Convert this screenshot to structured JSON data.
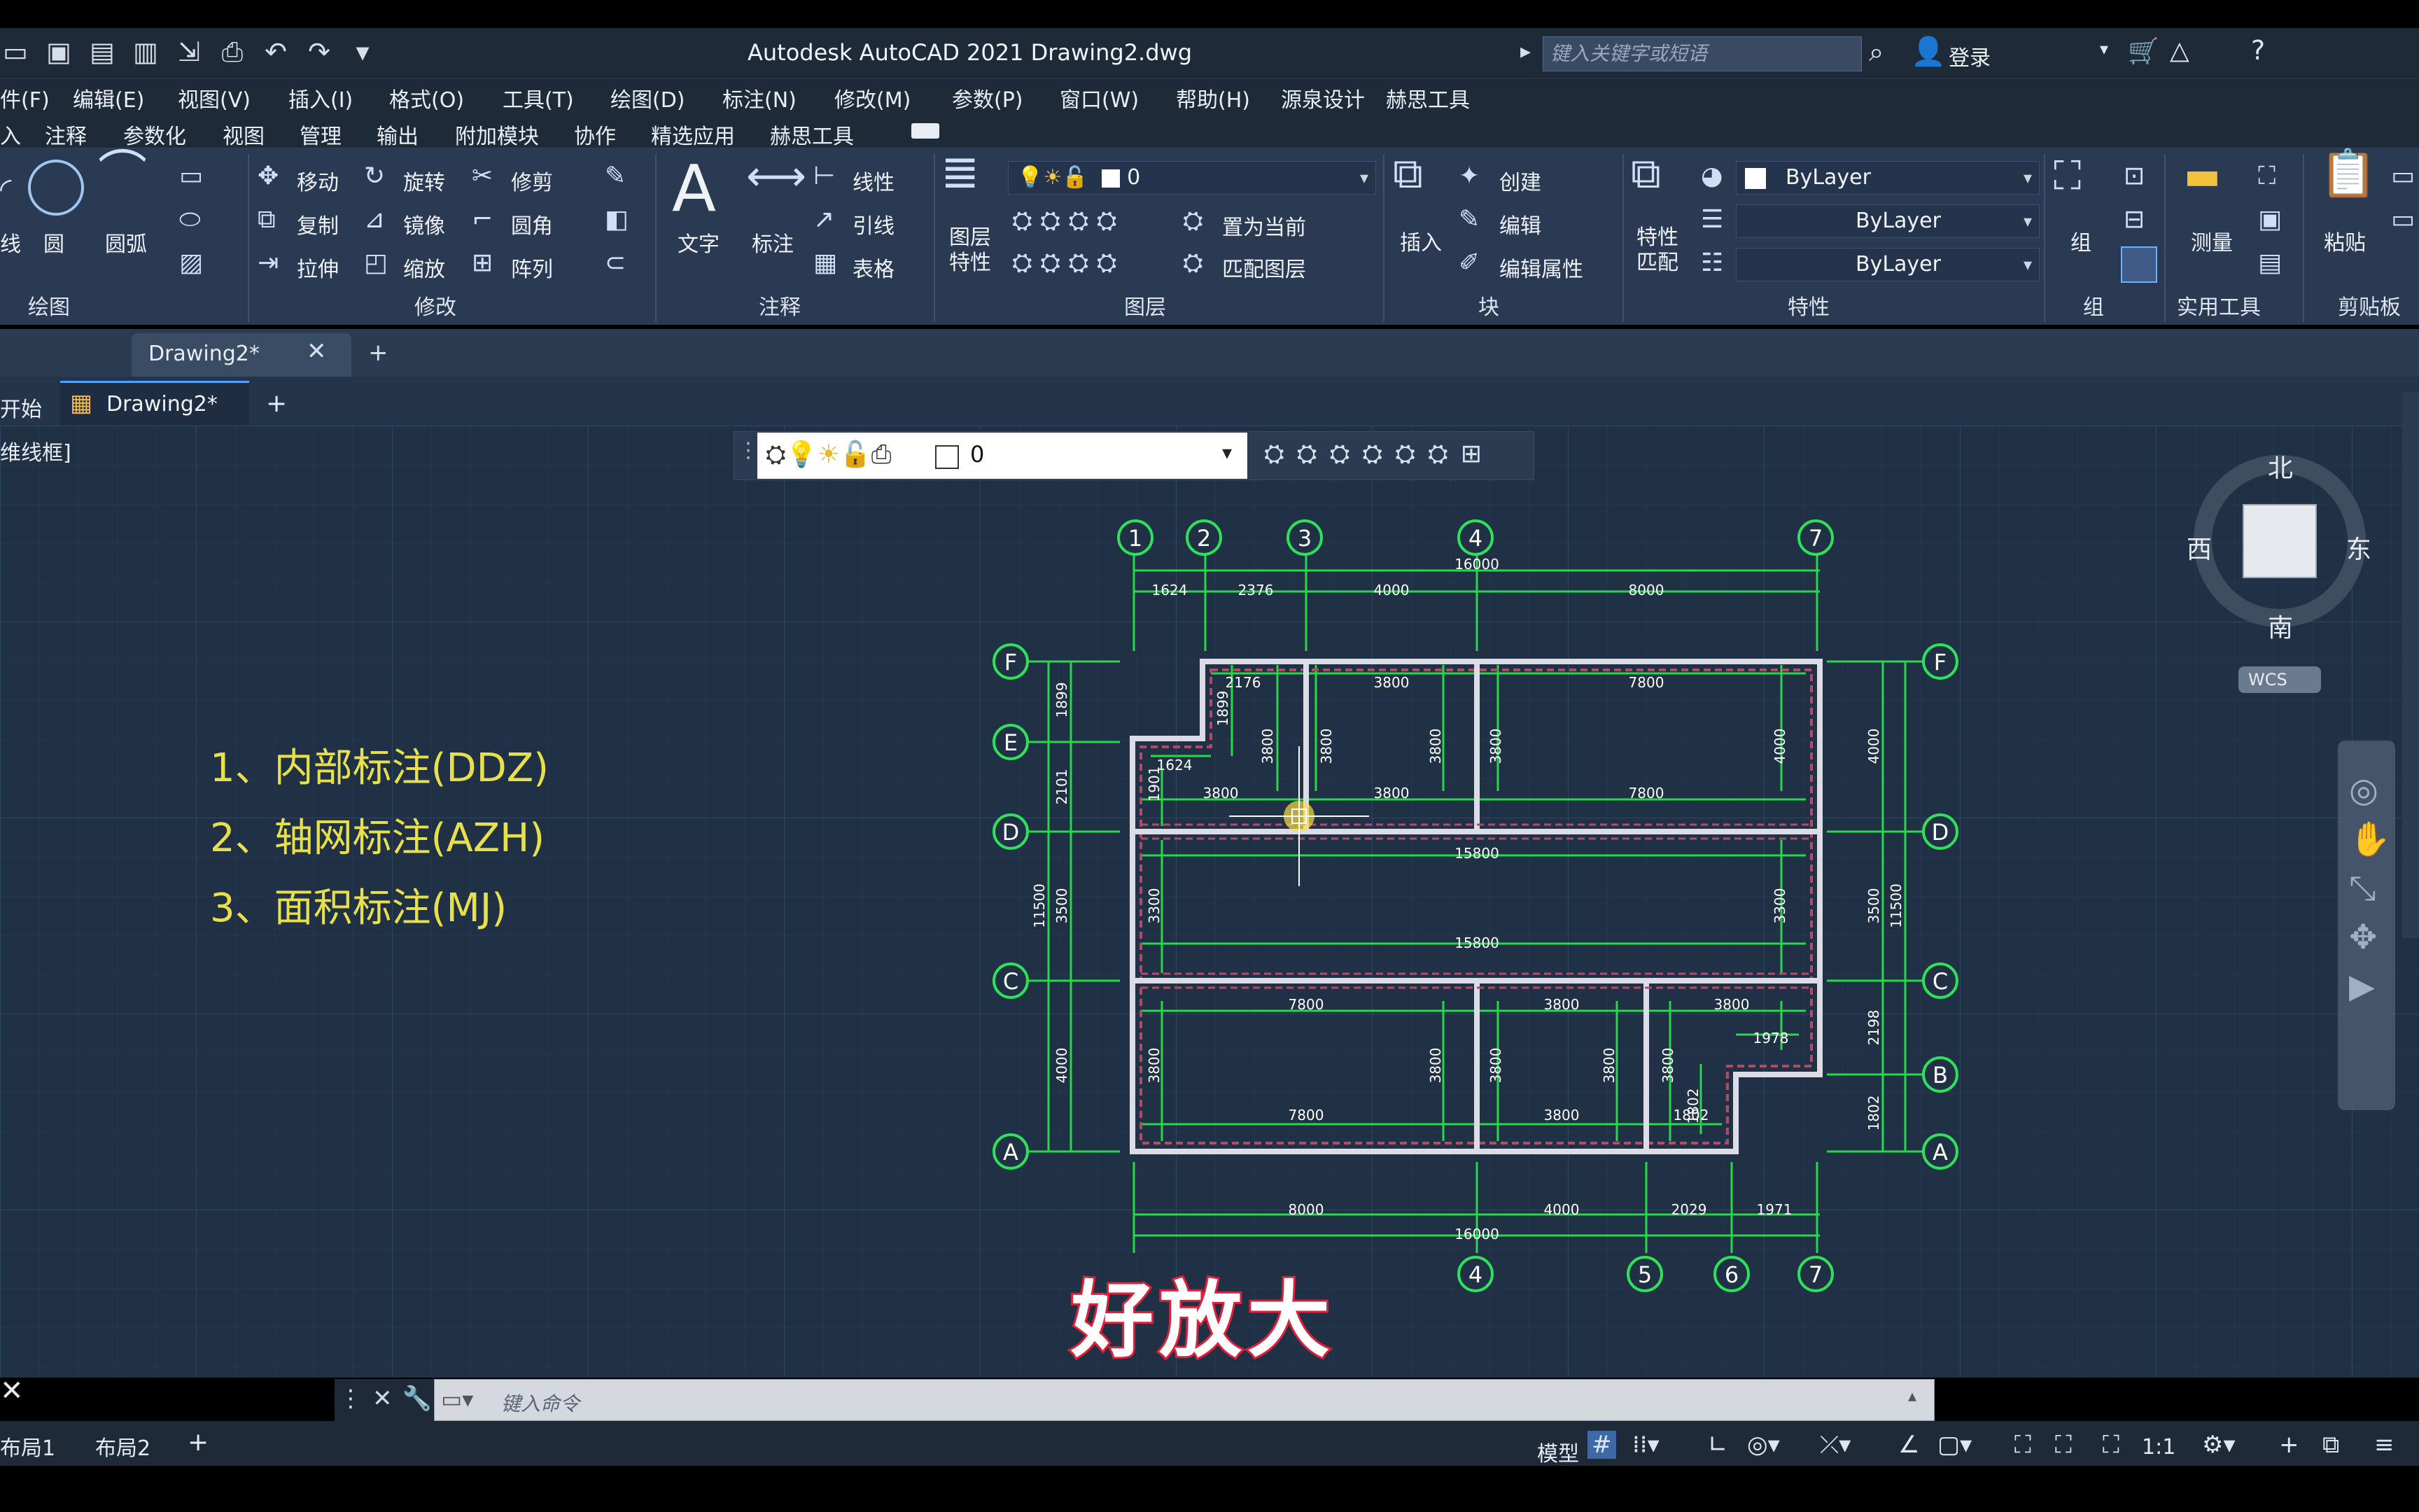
{
  "app": {
    "title": "Autodesk AutoCAD 2021    Drawing2.dwg",
    "search_placeholder": "键入关键字或短语",
    "login": "登录"
  },
  "menus": [
    "件(F)",
    "编辑(E)",
    "视图(V)",
    "插入(I)",
    "格式(O)",
    "工具(T)",
    "绘图(D)",
    "标注(N)",
    "修改(M)",
    "参数(P)",
    "窗口(W)",
    "帮助(H)",
    "源泉设计",
    "赫思工具"
  ],
  "ribbon_tabs": [
    "入",
    "注释",
    "参数化",
    "视图",
    "管理",
    "输出",
    "附加模块",
    "协作",
    "精选应用",
    "赫思工具"
  ],
  "ribbon": {
    "draw": {
      "line": "线",
      "circle": "圆",
      "arc": "圆弧",
      "group": "绘图"
    },
    "modify": {
      "move": "移动",
      "rotate": "旋转",
      "trim": "修剪",
      "copy": "复制",
      "mirror": "镜像",
      "fillet": "圆角",
      "stretch": "拉伸",
      "scale": "缩放",
      "array": "阵列",
      "group": "修改"
    },
    "annotation": {
      "text": "文字",
      "dimension": "标注",
      "linear": "线性",
      "leader": "引线",
      "table": "表格",
      "group": "注释"
    },
    "layers": {
      "properties": "图层\n特性",
      "current_layer": "0",
      "set_current": "置为当前",
      "match_layer": "匹配图层",
      "group": "图层"
    },
    "block": {
      "insert": "插入",
      "create": "创建",
      "edit": "编辑",
      "edit_attr": "编辑属性",
      "group": "块"
    },
    "properties": {
      "match": "特性\n匹配",
      "color": "ByLayer",
      "linetype": "ByLayer",
      "lineweight": "ByLayer",
      "group": "特性"
    },
    "groups": {
      "group": "组",
      "group_label": "组"
    },
    "utilities": {
      "measure": "测量",
      "group": "实用工具"
    },
    "clipboard": {
      "paste": "粘贴",
      "group": "剪贴板"
    }
  },
  "file_tab": "Drawing2*",
  "doc_tabs": {
    "start": "开始",
    "active": "Drawing2*"
  },
  "viewport_label": "[-][俯视][二维线框]",
  "viewport_label_visible": "维线框]",
  "float_layer_value": "0",
  "annotations": [
    "1、内部标注(DDZ)",
    "2、轴网标注(AZH)",
    "3、面积标注(MJ)"
  ],
  "viewcube": {
    "north": "北",
    "south": "南",
    "east": "东",
    "west": "西",
    "wcs": "WCS"
  },
  "drawing": {
    "top_axes": [
      "1",
      "2",
      "3",
      "4",
      "7"
    ],
    "bottom_axes": [
      "4",
      "5",
      "6",
      "7"
    ],
    "left_axes": [
      "F",
      "E",
      "D",
      "C",
      "A"
    ],
    "right_axes": [
      "F",
      "D",
      "C",
      "B",
      "A"
    ],
    "top_dims": [
      "1624",
      "2376",
      "4000",
      "8000"
    ],
    "top_total": "16000",
    "bottom_dims": [
      "8000",
      "4000",
      "2029",
      "1971"
    ],
    "bottom_total": "16000",
    "left_dims": [
      "1899",
      "2101",
      "3500",
      "4000"
    ],
    "left_total": "11500",
    "right_dims": [
      "4000",
      "3500",
      "2198",
      "1802"
    ],
    "right_total": "11500",
    "inner": [
      "2176",
      "3800",
      "7800",
      "1899",
      "3800",
      "3800",
      "3800",
      "3800",
      "4000",
      "1624",
      "1901",
      "3800",
      "3800",
      "7800",
      "15800",
      "3300",
      "15800",
      "3300",
      "3500",
      "3500",
      "7800",
      "3800",
      "3800",
      "1978",
      "3800",
      "3800",
      "3800",
      "3800",
      "3800",
      "1802",
      "7800",
      "3800",
      "1802"
    ]
  },
  "subtitle": "好放大",
  "command_placeholder": "键入命令",
  "layout_tabs": [
    "布局1",
    "布局2"
  ],
  "status": {
    "model": "模型",
    "scale": "1:1"
  },
  "colors": {
    "canvas": "#213145",
    "dim": "#27d84a",
    "axis": "#2ee05a",
    "wall": "#d8d8e0",
    "annot": "#e8e04a"
  }
}
